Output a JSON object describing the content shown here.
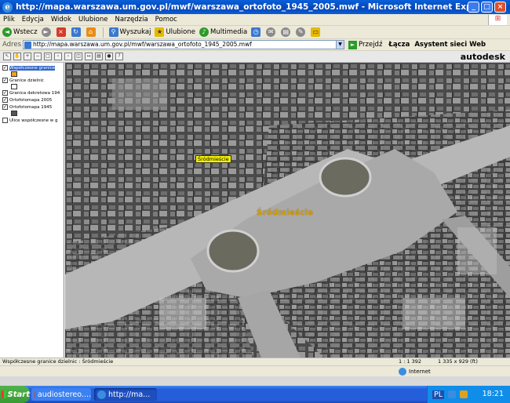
{
  "window": {
    "title": "http://mapa.warszawa.um.gov.pl/mwf/warszawa_ortofoto_1945_2005.mwf - Microsoft Internet Explorer"
  },
  "menu": [
    "Plik",
    "Edycja",
    "Widok",
    "Ulubione",
    "Narzędzia",
    "Pomoc"
  ],
  "toolbar": {
    "back": "Wstecz",
    "search": "Wyszukaj",
    "favorites": "Ulubione",
    "multimedia": "Multimedia"
  },
  "address": {
    "label": "Adres",
    "url": "http://mapa.warszawa.um.gov.pl/mwf/warszawa_ortofoto_1945_2005.mwf",
    "go": "Przejdź",
    "links": "Łącza",
    "assistant": "Asystent sieci Web"
  },
  "app": {
    "brand": "autodesk"
  },
  "layers": [
    {
      "label": "Współczesne granice",
      "checked": true
    },
    {
      "label": "Granice dzielnic",
      "checked": true
    },
    {
      "label": "Granica dekretowa 194",
      "checked": true
    },
    {
      "label": "Ortofotomapa 2005",
      "checked": true
    },
    {
      "label": "Ortofotomapa 1945",
      "checked": true
    },
    {
      "label": "Ulice współczesne w g",
      "checked": false
    }
  ],
  "map": {
    "label_box": "Śródmieście",
    "label_text": "Śródmieście"
  },
  "app_status": {
    "left": "Współczesne granice dzielnic : Śródmieście",
    "scale": "1 : 1 392",
    "size": "1 335 x 929 (ft)"
  },
  "ie_status": {
    "zone": "Internet"
  },
  "taskbar": {
    "start": "Start",
    "tasks": [
      "audiostereo....",
      "http://ma..."
    ],
    "language": "PL",
    "clock": "18:21"
  },
  "colors": {
    "titlebar": "#0a5fd8",
    "label_box": "#f4f000",
    "label_text": "#d9a000",
    "taskbar": "#245edb"
  }
}
